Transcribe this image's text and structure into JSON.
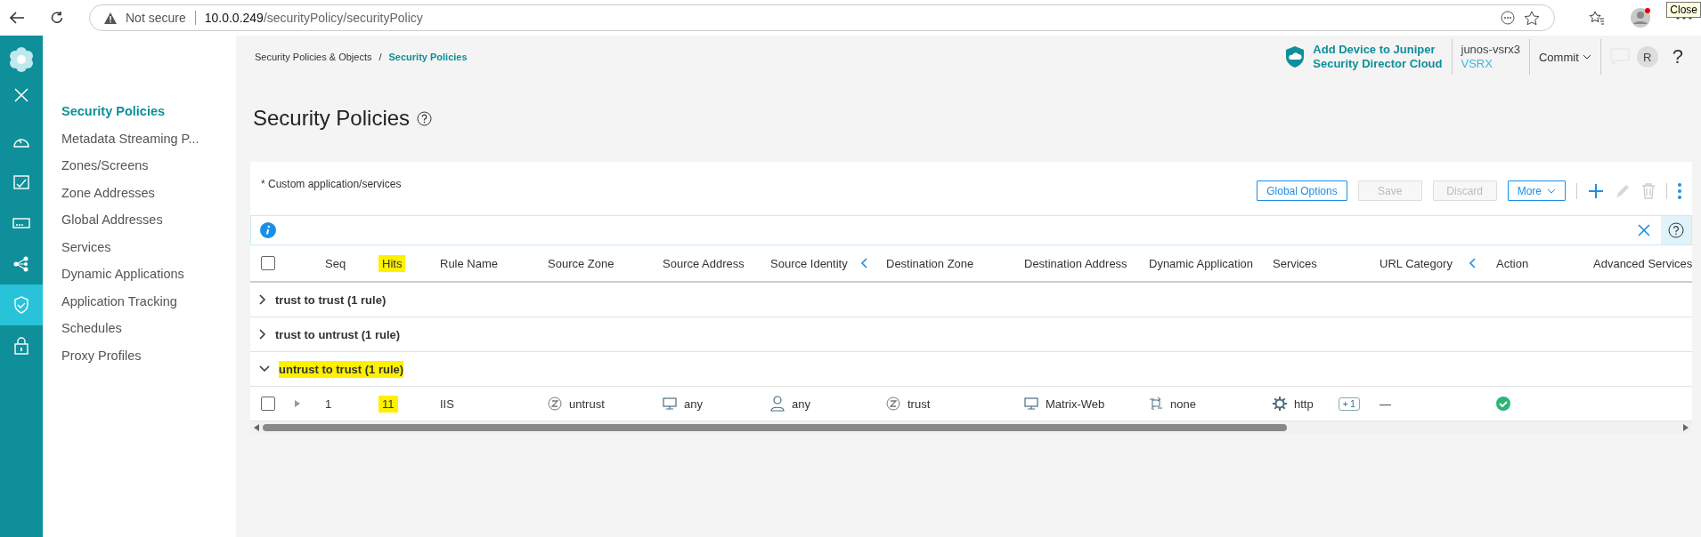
{
  "browser": {
    "security_label": "Not secure",
    "url_host": "10.0.0.249",
    "url_path": "/securityPolicy/securityPolicy",
    "tooltip": "Close"
  },
  "rail": [
    {
      "kind": "dashboard",
      "selected": false
    },
    {
      "kind": "monitor",
      "selected": false
    },
    {
      "kind": "devices",
      "selected": false
    },
    {
      "kind": "network",
      "selected": false
    },
    {
      "kind": "security",
      "selected": true
    },
    {
      "kind": "lock",
      "selected": false
    }
  ],
  "nav": [
    {
      "label": "Security Policies",
      "selected": true
    },
    {
      "label": "Metadata Streaming P...",
      "selected": false
    },
    {
      "label": "Zones/Screens",
      "selected": false
    },
    {
      "label": "Zone Addresses",
      "selected": false
    },
    {
      "label": "Global Addresses",
      "selected": false
    },
    {
      "label": "Services",
      "selected": false
    },
    {
      "label": "Dynamic Applications",
      "selected": false
    },
    {
      "label": "Application Tracking",
      "selected": false
    },
    {
      "label": "Schedules",
      "selected": false
    },
    {
      "label": "Proxy Profiles",
      "selected": false
    }
  ],
  "breadcrumb": [
    {
      "label": "Security Policies & Objects",
      "selected": false
    },
    {
      "label": "/",
      "selected": false
    },
    {
      "label": "Security Policies",
      "selected": true
    }
  ],
  "header": {
    "cloud_link": [
      "Add Device to Juniper",
      "Security Director Cloud"
    ],
    "device_name": "junos-vsrx3",
    "device_model": "VSRX",
    "commit": "Commit",
    "avatar": "R",
    "help": "?"
  },
  "page": {
    "title": "Security Policies",
    "note": "* Custom application/services"
  },
  "toolbar": [
    {
      "label": "Global Options",
      "disabled": false,
      "kind": "button"
    },
    {
      "label": "Save",
      "disabled": true,
      "kind": "button"
    },
    {
      "label": "Discard",
      "disabled": true,
      "kind": "button"
    },
    {
      "label": "More",
      "disabled": false,
      "kind": "menu"
    }
  ],
  "select_all": {
    "checked": false
  },
  "columns": [
    {
      "label": "Seq",
      "highlighted": false
    },
    {
      "label": "Hits",
      "highlighted": true
    },
    {
      "label": "Rule Name",
      "highlighted": false
    },
    {
      "label": "Source Zone",
      "highlighted": false
    },
    {
      "label": "Source Address",
      "highlighted": false
    },
    {
      "label": "Source Identity",
      "highlighted": false
    },
    {
      "label": "Destination Zone",
      "highlighted": false
    },
    {
      "label": "Destination Address",
      "highlighted": false
    },
    {
      "label": "Dynamic Application",
      "highlighted": false
    },
    {
      "label": "Services",
      "highlighted": false
    },
    {
      "label": "URL Category",
      "highlighted": false
    },
    {
      "label": "Action",
      "highlighted": false
    },
    {
      "label": "Advanced Services",
      "highlighted": false
    }
  ],
  "groups": [
    {
      "label": "trust to trust (1 rule)",
      "expanded": false,
      "highlighted": false
    },
    {
      "label": "trust to untrust (1 rule)",
      "expanded": false,
      "highlighted": false
    },
    {
      "label": "untrust to trust (1 rule)",
      "expanded": true,
      "highlighted": true,
      "rows": [
        {
          "checked": false,
          "seq": "1",
          "hits": "11",
          "hits_highlighted": true,
          "rule_name": "IIS",
          "source_zone": "untrust",
          "source_address": "any",
          "source_identity": "any",
          "destination_zone": "trust",
          "destination_address": "Matrix-Web",
          "dynamic_application": "none",
          "services": "http",
          "services_more": "+ 1",
          "url_category": "—",
          "action": {
            "kind": "permit"
          }
        }
      ]
    }
  ]
}
